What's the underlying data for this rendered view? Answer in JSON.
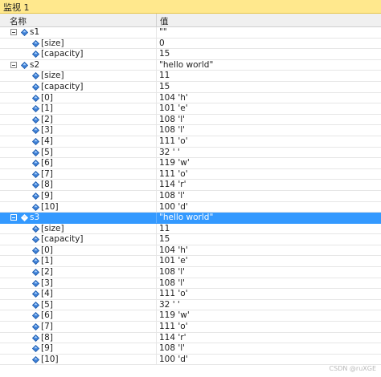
{
  "window": {
    "title": "监视 1"
  },
  "columns": {
    "name": "名称",
    "value": "值"
  },
  "rows": [
    {
      "level": 0,
      "expander": true,
      "name": "s1",
      "value": "\"\"",
      "selected": false
    },
    {
      "level": 1,
      "expander": false,
      "name": "[size]",
      "value": "0",
      "selected": false
    },
    {
      "level": 1,
      "expander": false,
      "name": "[capacity]",
      "value": "15",
      "selected": false
    },
    {
      "level": 0,
      "expander": true,
      "name": "s2",
      "value": "\"hello world\"",
      "selected": false
    },
    {
      "level": 1,
      "expander": false,
      "name": "[size]",
      "value": "11",
      "selected": false
    },
    {
      "level": 1,
      "expander": false,
      "name": "[capacity]",
      "value": "15",
      "selected": false
    },
    {
      "level": 1,
      "expander": false,
      "name": "[0]",
      "value": "104 'h'",
      "selected": false
    },
    {
      "level": 1,
      "expander": false,
      "name": "[1]",
      "value": "101 'e'",
      "selected": false
    },
    {
      "level": 1,
      "expander": false,
      "name": "[2]",
      "value": "108 'l'",
      "selected": false
    },
    {
      "level": 1,
      "expander": false,
      "name": "[3]",
      "value": "108 'l'",
      "selected": false
    },
    {
      "level": 1,
      "expander": false,
      "name": "[4]",
      "value": "111 'o'",
      "selected": false
    },
    {
      "level": 1,
      "expander": false,
      "name": "[5]",
      "value": "32 ' '",
      "selected": false
    },
    {
      "level": 1,
      "expander": false,
      "name": "[6]",
      "value": "119 'w'",
      "selected": false
    },
    {
      "level": 1,
      "expander": false,
      "name": "[7]",
      "value": "111 'o'",
      "selected": false
    },
    {
      "level": 1,
      "expander": false,
      "name": "[8]",
      "value": "114 'r'",
      "selected": false
    },
    {
      "level": 1,
      "expander": false,
      "name": "[9]",
      "value": "108 'l'",
      "selected": false
    },
    {
      "level": 1,
      "expander": false,
      "name": "[10]",
      "value": "100 'd'",
      "selected": false
    },
    {
      "level": 0,
      "expander": true,
      "name": "s3",
      "value": "\"hello world\"",
      "selected": true
    },
    {
      "level": 1,
      "expander": false,
      "name": "[size]",
      "value": "11",
      "selected": false
    },
    {
      "level": 1,
      "expander": false,
      "name": "[capacity]",
      "value": "15",
      "selected": false
    },
    {
      "level": 1,
      "expander": false,
      "name": "[0]",
      "value": "104 'h'",
      "selected": false
    },
    {
      "level": 1,
      "expander": false,
      "name": "[1]",
      "value": "101 'e'",
      "selected": false
    },
    {
      "level": 1,
      "expander": false,
      "name": "[2]",
      "value": "108 'l'",
      "selected": false
    },
    {
      "level": 1,
      "expander": false,
      "name": "[3]",
      "value": "108 'l'",
      "selected": false
    },
    {
      "level": 1,
      "expander": false,
      "name": "[4]",
      "value": "111 'o'",
      "selected": false
    },
    {
      "level": 1,
      "expander": false,
      "name": "[5]",
      "value": "32 ' '",
      "selected": false
    },
    {
      "level": 1,
      "expander": false,
      "name": "[6]",
      "value": "119 'w'",
      "selected": false
    },
    {
      "level": 1,
      "expander": false,
      "name": "[7]",
      "value": "111 'o'",
      "selected": false
    },
    {
      "level": 1,
      "expander": false,
      "name": "[8]",
      "value": "114 'r'",
      "selected": false
    },
    {
      "level": 1,
      "expander": false,
      "name": "[9]",
      "value": "108 'l'",
      "selected": false
    },
    {
      "level": 1,
      "expander": false,
      "name": "[10]",
      "value": "100 'd'",
      "selected": false
    }
  ],
  "icons": {
    "expander": "collapse-minus-icon",
    "variable": "variable-gem-icon"
  },
  "colors": {
    "selection": "#3399ff",
    "title_bar": "#ffe88d",
    "gem": "#3c7fd6"
  },
  "watermark": "CSDN @ruXGE"
}
